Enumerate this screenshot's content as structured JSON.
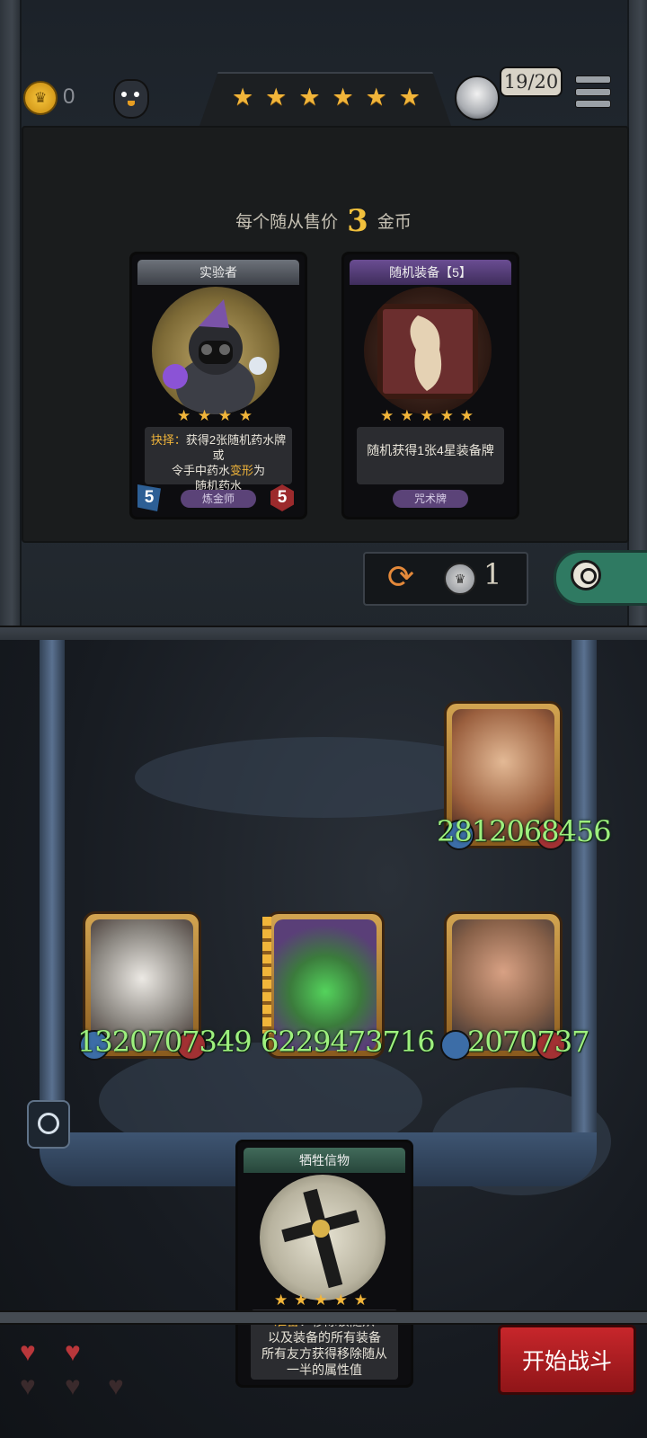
{
  "header": {
    "gold_count": "0",
    "tavern_stars": 6,
    "hero_counter": "19/20"
  },
  "shop": {
    "sell_price_prefix": "每个随从售价",
    "sell_price_value": "3",
    "sell_price_suffix": "金币",
    "cards": [
      {
        "title": "实验者",
        "stars": 4,
        "text_keyword": "抉择：",
        "text_body_1": "获得2张随机药水牌或",
        "text_body_2a": "令手中药水",
        "text_body_2_highlight": "变形",
        "text_body_2b": "为",
        "text_body_3": "随机药水",
        "tag": "炼金师",
        "attack": "5",
        "health": "5"
      },
      {
        "title": "随机装备【5】",
        "stars": 5,
        "text_body_1": "随机获得1张4星装备牌",
        "tag": "咒术牌"
      }
    ],
    "refresh_cost": "1"
  },
  "board": {
    "minions": [
      {
        "name": "strongman-minion",
        "stats_text": "2812068456"
      },
      {
        "name": "rabbit-mask-minion",
        "stats_text": "1320707349"
      },
      {
        "name": "slime-minion",
        "stats_text": "6229473716"
      },
      {
        "name": "mad-scientist-minion",
        "stats_text": "2070737"
      }
    ]
  },
  "hand_card": {
    "title": "牺牲信物",
    "stars": 5,
    "text_keyword": "准备",
    "text_body_1": "：移除该随从",
    "text_body_2": "以及装备的所有装备",
    "text_body_3": "所有友方获得移除随从",
    "text_body_4": "一半的属性值"
  },
  "lives": {
    "full": 2,
    "empty": 3
  },
  "start_button_label": "开始战斗",
  "colors": {
    "gold": "#f1b53a",
    "stat_green": "#9ef07e",
    "start_red": "#c7262b"
  }
}
